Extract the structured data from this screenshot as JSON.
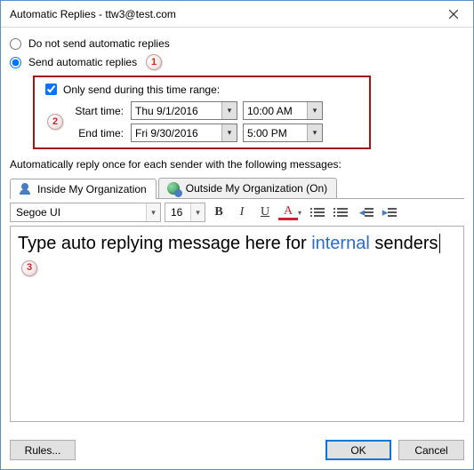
{
  "window": {
    "title": "Automatic Replies - ttw3@test.com"
  },
  "options": {
    "do_not_send": "Do not send automatic replies",
    "send": "Send automatic replies",
    "send_selected": true
  },
  "callouts": {
    "c1": "1",
    "c2": "2",
    "c3": "3"
  },
  "time_range": {
    "checkbox_label": "Only send during this time range:",
    "checked": true,
    "start_label": "Start time:",
    "start_date": "Thu 9/1/2016",
    "start_time": "10:00 AM",
    "end_label": "End time:",
    "end_date": "Fri 9/30/2016",
    "end_time": "5:00 PM"
  },
  "instruction": "Automatically reply once for each sender with the following messages:",
  "tabs": {
    "inside": "Inside My Organization",
    "outside": "Outside My Organization (On)"
  },
  "toolbar": {
    "font_name": "Segoe UI",
    "font_size": "16"
  },
  "editor": {
    "part1": "Type auto replying message here for ",
    "link": "internal",
    "part2": " senders"
  },
  "footer": {
    "rules": "Rules...",
    "ok": "OK",
    "cancel": "Cancel"
  }
}
